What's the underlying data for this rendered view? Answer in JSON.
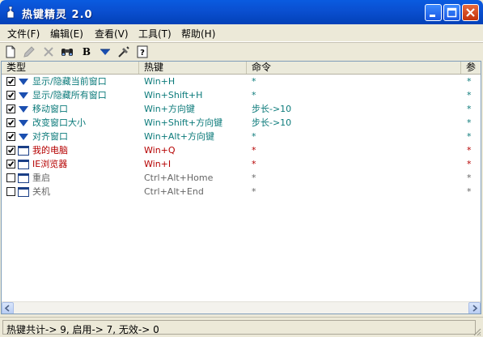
{
  "window": {
    "title": "热键精灵 2.0"
  },
  "menu": [
    {
      "label": "文件(F)"
    },
    {
      "label": "编辑(E)"
    },
    {
      "label": "查看(V)"
    },
    {
      "label": "工具(T)"
    },
    {
      "label": "帮助(H)"
    }
  ],
  "toolbar": {
    "bold_label": "B"
  },
  "columns": [
    "类型",
    "热键",
    "命令",
    "参"
  ],
  "rows": [
    {
      "checked": true,
      "icon": "arrow-down-icon",
      "name": "显示/隐藏当前窗口",
      "hotkey": "Win+H",
      "command": "*",
      "param": "*",
      "color": "#0b7a7a"
    },
    {
      "checked": true,
      "icon": "arrow-down-icon",
      "name": "显示/隐藏所有窗口",
      "hotkey": "Win+Shift+H",
      "command": "*",
      "param": "*",
      "color": "#0b7a7a"
    },
    {
      "checked": true,
      "icon": "arrow-down-icon",
      "name": "移动窗口",
      "hotkey": "Win+方向键",
      "command": "步长->10",
      "param": "*",
      "color": "#0b7a7a"
    },
    {
      "checked": true,
      "icon": "arrow-down-icon",
      "name": "改变窗口大小",
      "hotkey": "Win+Shift+方向键",
      "command": "步长->10",
      "param": "*",
      "color": "#0b7a7a"
    },
    {
      "checked": true,
      "icon": "arrow-down-icon",
      "name": "对齐窗口",
      "hotkey": "Win+Alt+方向键",
      "command": "*",
      "param": "*",
      "color": "#0b7a7a"
    },
    {
      "checked": true,
      "icon": "window-icon",
      "name": "我的电脑",
      "hotkey": "Win+Q",
      "command": "*",
      "param": "*",
      "color": "#b50000"
    },
    {
      "checked": true,
      "icon": "window-icon",
      "name": "IE浏览器",
      "hotkey": "Win+I",
      "command": "*",
      "param": "*",
      "color": "#b50000"
    },
    {
      "checked": false,
      "icon": "window-icon",
      "name": "重启",
      "hotkey": "Ctrl+Alt+Home",
      "command": "*",
      "param": "*",
      "color": "#666666"
    },
    {
      "checked": false,
      "icon": "window-icon",
      "name": "关机",
      "hotkey": "Ctrl+Alt+End",
      "command": "*",
      "param": "*",
      "color": "#666666"
    }
  ],
  "status": {
    "text": "热键共计-> 9, 启用-> 7, 无效-> 0"
  }
}
